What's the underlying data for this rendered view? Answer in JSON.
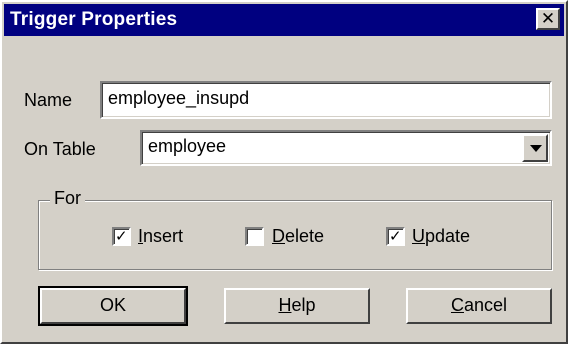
{
  "window": {
    "title": "Trigger Properties",
    "close_glyph": "✕"
  },
  "form": {
    "name_label": "Name",
    "name_value": "employee_insupd",
    "table_label": "On Table",
    "table_value": "employee"
  },
  "for_group": {
    "legend": "For",
    "options": [
      {
        "mnemonic": "I",
        "rest": "nsert",
        "checked": true
      },
      {
        "mnemonic": "D",
        "rest": "elete",
        "checked": false
      },
      {
        "mnemonic": "U",
        "rest": "pdate",
        "checked": true
      }
    ]
  },
  "buttons": {
    "ok": "OK",
    "help_mnemonic": "H",
    "help_rest": "elp",
    "cancel_mnemonic": "C",
    "cancel_rest": "ancel"
  },
  "check_glyph": "✓",
  "colors": {
    "titlebar": "#000080",
    "face": "#d4d0c8"
  }
}
